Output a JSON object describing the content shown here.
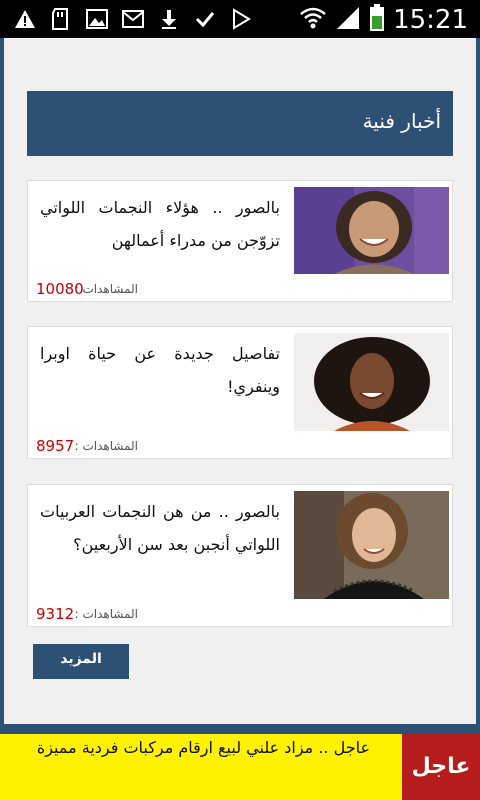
{
  "status_bar": {
    "time": "15:21",
    "left_icons": [
      "warning-icon",
      "sd-card-icon",
      "image-icon",
      "gmail-icon",
      "download-icon",
      "check-icon",
      "play-store-icon"
    ],
    "right_icons": [
      "wifi-icon",
      "signal-icon",
      "battery-icon"
    ]
  },
  "section": {
    "title": "أخبار فنية"
  },
  "articles": [
    {
      "headline": "بالصور .. هؤلاء النجمات اللواتي تزوّجن من مدراء أعمالهن",
      "views_label": "المشاهدات :",
      "views": "10080"
    },
    {
      "headline": "تفاصيل جديدة عن حياة اوبرا وينفري!",
      "views_label": "المشاهدات :",
      "views": "8957"
    },
    {
      "headline": "بالصور .. من هن النجمات العربيات اللواتي أنجبن بعد سن الأربعين؟",
      "views_label": "المشاهدات :",
      "views": "9312"
    }
  ],
  "more_button": {
    "label": "المزيد"
  },
  "ticker": {
    "badge": "عاجل",
    "text": "عاجل .. مزاد علني لبيع ارقام مركبات فردية مميزة"
  },
  "colors": {
    "primary": "#2d5075",
    "ticker_bg": "#fff200",
    "badge_bg": "#b71c1c",
    "views": "#cc0000"
  }
}
